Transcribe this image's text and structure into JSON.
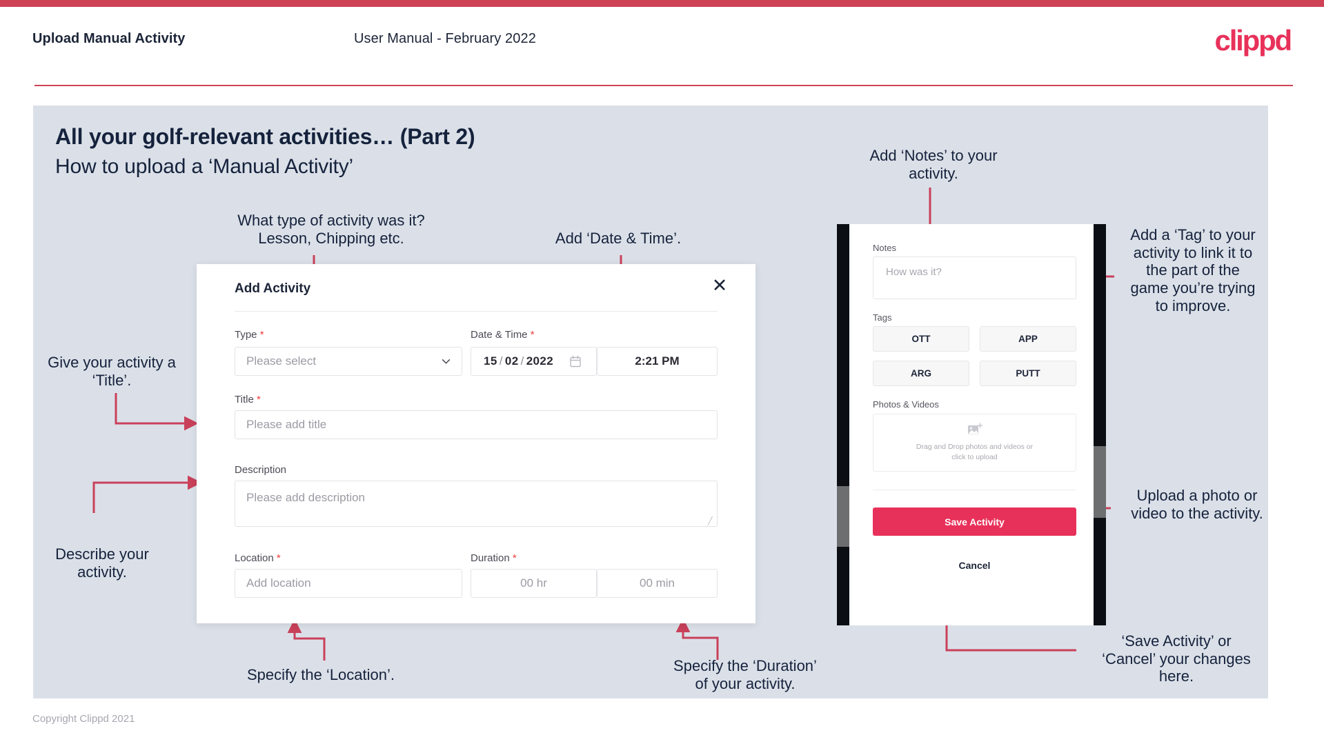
{
  "colors": {
    "brand": "#e8315a",
    "bar": "#cf4256",
    "slide_bg": "#dbe0e8",
    "ink": "#15223c",
    "arrow": "#c9405a",
    "required": "#ee3b3b"
  },
  "header": {
    "title": "Upload Manual Activity",
    "subtitle": "User Manual - February 2022",
    "logo": "clippd"
  },
  "slide": {
    "title": "All your golf-relevant activities… (Part 2)",
    "subtitle": "How to upload a ‘Manual Activity’"
  },
  "dialog": {
    "title": "Add Activity",
    "close_icon": "close-icon",
    "type": {
      "label": "Type",
      "required": "*",
      "placeholder": "Please select",
      "chevron_icon": "chevron-down-icon"
    },
    "datetime": {
      "label": "Date & Time",
      "required": "*",
      "day": "15",
      "month": "02",
      "year": "2022",
      "separator": "/",
      "calendar_icon": "calendar-icon",
      "time": "2:21 PM"
    },
    "title_field": {
      "label": "Title",
      "required": "*",
      "placeholder": "Please add title"
    },
    "description": {
      "label": "Description",
      "placeholder": "Please add description"
    },
    "location": {
      "label": "Location",
      "required": "*",
      "placeholder": "Add location"
    },
    "duration": {
      "label": "Duration",
      "required": "*",
      "hours_placeholder": "00 hr",
      "minutes_placeholder": "00 min"
    }
  },
  "phone": {
    "notes": {
      "label": "Notes",
      "placeholder": "How was it?"
    },
    "tags": {
      "label": "Tags",
      "items": [
        "OTT",
        "APP",
        "ARG",
        "PUTT"
      ]
    },
    "photos": {
      "label": "Photos & Videos",
      "icon": "add-image-icon",
      "dropzone_line1": "Drag and Drop photos and videos or",
      "dropzone_line2": "click to upload"
    },
    "save_label": "Save Activity",
    "cancel_label": "Cancel"
  },
  "annotations": {
    "type": "What type of activity was it?\nLesson, Chipping etc.",
    "datetime": "Add ‘Date & Time’.",
    "title": "Give your activity a\n‘Title’.",
    "description": "Describe your\nactivity.",
    "location": "Specify the ‘Location’.",
    "duration": "Specify the ‘Duration’\nof your activity.",
    "notes": "Add ‘Notes’ to your\nactivity.",
    "tags": "Add a ‘Tag’ to your\nactivity to link it to\nthe part of the\ngame you’re trying\nto improve.",
    "upload": "Upload a photo or\nvideo to the activity.",
    "save": "‘Save Activity’ or\n‘Cancel’ your changes\nhere."
  },
  "footer": {
    "copyright": "Copyright Clippd 2021"
  }
}
